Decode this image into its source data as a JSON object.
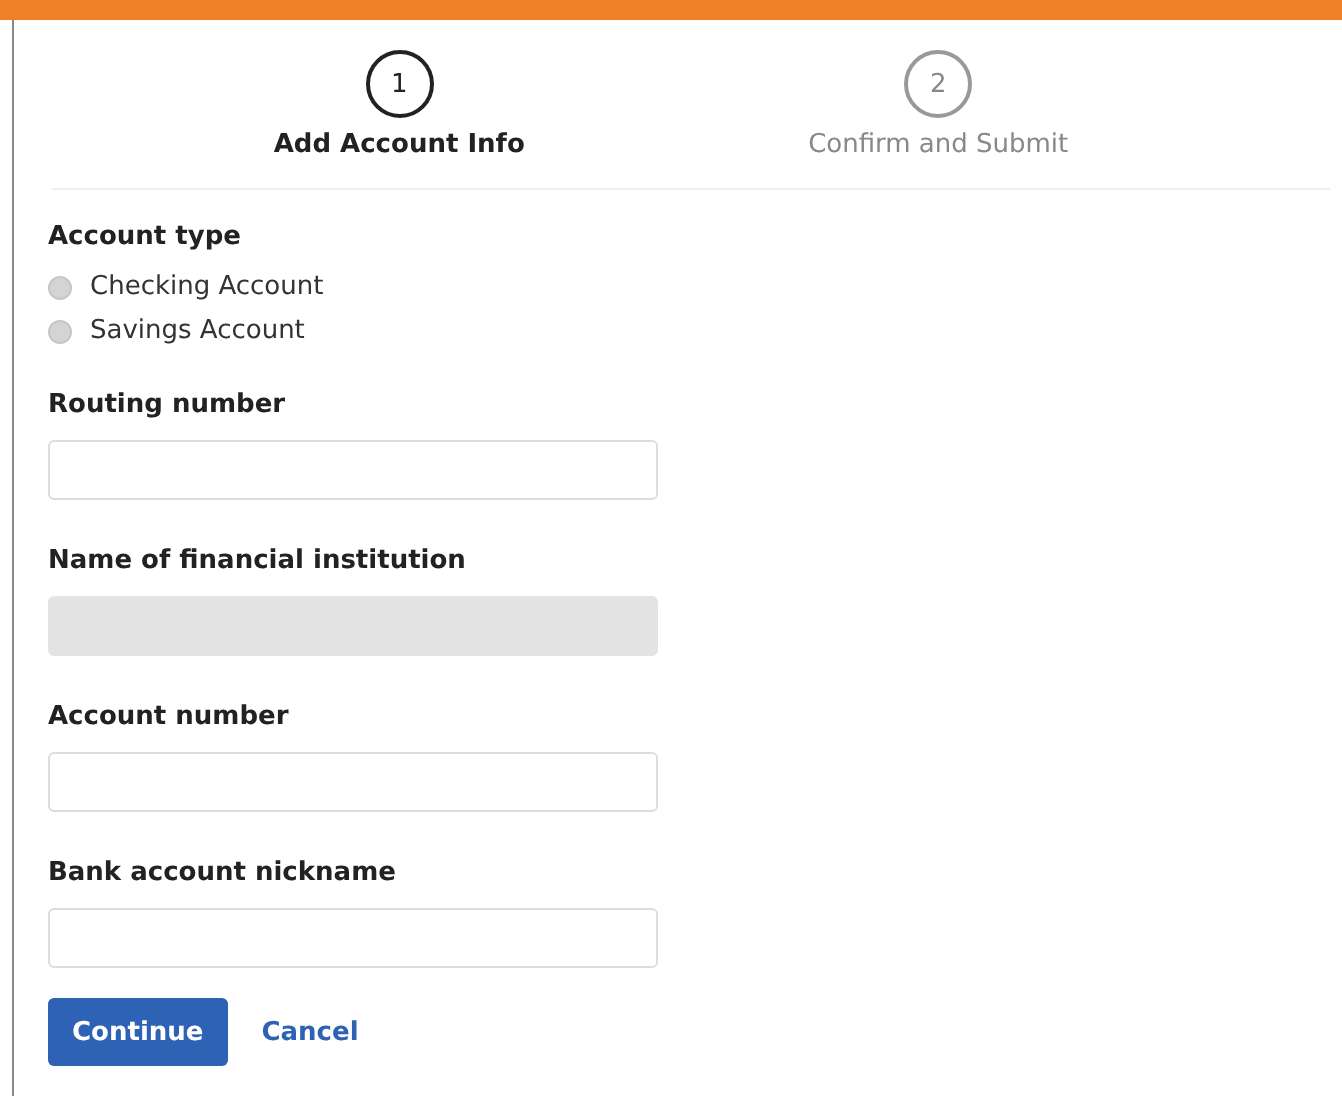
{
  "steps": [
    {
      "number": "1",
      "label": "Add Account Info",
      "selected": true
    },
    {
      "number": "2",
      "label": "Confirm and Submit",
      "selected": false
    }
  ],
  "account_type": {
    "label": "Account type",
    "options": [
      {
        "label": "Checking Account",
        "selected": false
      },
      {
        "label": "Savings Account",
        "selected": false
      }
    ]
  },
  "fields": [
    {
      "label": "Routing number",
      "disabled": false
    },
    {
      "label": "Name of financial institution",
      "disabled": true
    },
    {
      "label": "Account number",
      "disabled": false
    },
    {
      "label": "Bank account nickname",
      "disabled": false
    }
  ],
  "buttons": {
    "primary": "Continue",
    "cancel": "Cancel"
  }
}
